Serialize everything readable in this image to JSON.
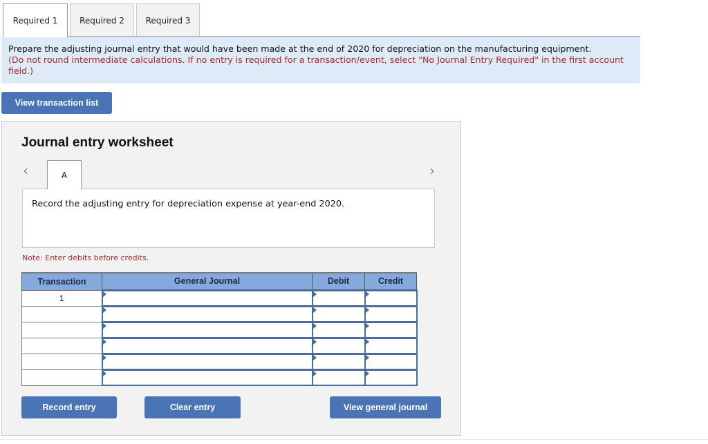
{
  "tabs": [
    {
      "label": "Required 1",
      "active": true
    },
    {
      "label": "Required 2",
      "active": false
    },
    {
      "label": "Required 3",
      "active": false
    }
  ],
  "instructions": {
    "main": "Prepare the adjusting journal entry that would have been made at the end of 2020 for depreciation on the manufacturing equipment.",
    "note": "(Do not round intermediate calculations. If no entry is required for a transaction/event, select \"No Journal Entry Required\" in the first account field.)"
  },
  "buttons": {
    "view_transaction_list": "View transaction list",
    "record_entry": "Record entry",
    "clear_entry": "Clear entry",
    "view_general_journal": "View general journal"
  },
  "worksheet": {
    "title": "Journal entry worksheet",
    "prev_icon": "‹",
    "next_icon": "›",
    "step_tab": "A",
    "prompt": "Record the adjusting entry for depreciation expense at year-end 2020.",
    "note": "Note: Enter debits before credits.",
    "table": {
      "headers": [
        "Transaction",
        "General Journal",
        "Debit",
        "Credit"
      ],
      "rows": [
        {
          "transaction": "1",
          "account": "",
          "debit": "",
          "credit": ""
        },
        {
          "transaction": "",
          "account": "",
          "debit": "",
          "credit": ""
        },
        {
          "transaction": "",
          "account": "",
          "debit": "",
          "credit": ""
        },
        {
          "transaction": "",
          "account": "",
          "debit": "",
          "credit": ""
        },
        {
          "transaction": "",
          "account": "",
          "debit": "",
          "credit": ""
        },
        {
          "transaction": "",
          "account": "",
          "debit": "",
          "credit": ""
        }
      ]
    }
  },
  "colors": {
    "accent_button": "#4a74b5",
    "banner_bg": "#deeaf7",
    "table_header_bg": "#86a9dd",
    "warning_text": "#a52a2a"
  }
}
